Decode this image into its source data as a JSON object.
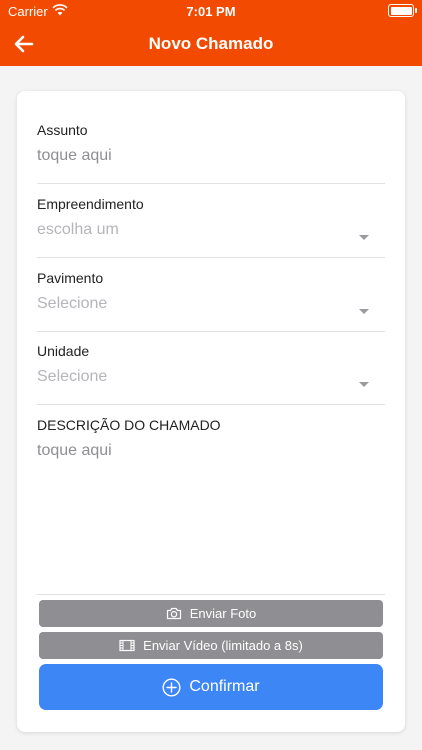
{
  "status_bar": {
    "carrier": "Carrier",
    "time": "7:01 PM"
  },
  "header": {
    "title": "Novo Chamado",
    "back_icon": "arrow-left-icon"
  },
  "form": {
    "assunto": {
      "label": "Assunto",
      "placeholder": "toque aqui"
    },
    "empreendimento": {
      "label": "Empreendimento",
      "placeholder": "escolha um"
    },
    "pavimento": {
      "label": "Pavimento",
      "placeholder": "Selecione"
    },
    "unidade": {
      "label": "Unidade",
      "placeholder": "Selecione"
    },
    "descricao": {
      "label": "DESCRIÇÃO DO CHAMADO",
      "placeholder": "toque aqui"
    }
  },
  "buttons": {
    "foto": "Enviar Foto",
    "video": "Enviar Vídeo (limitado a 8s)",
    "confirmar": "Confirmar"
  },
  "colors": {
    "header": "#f24a00",
    "gray_button": "#8e8e93",
    "primary": "#3d86f6"
  }
}
